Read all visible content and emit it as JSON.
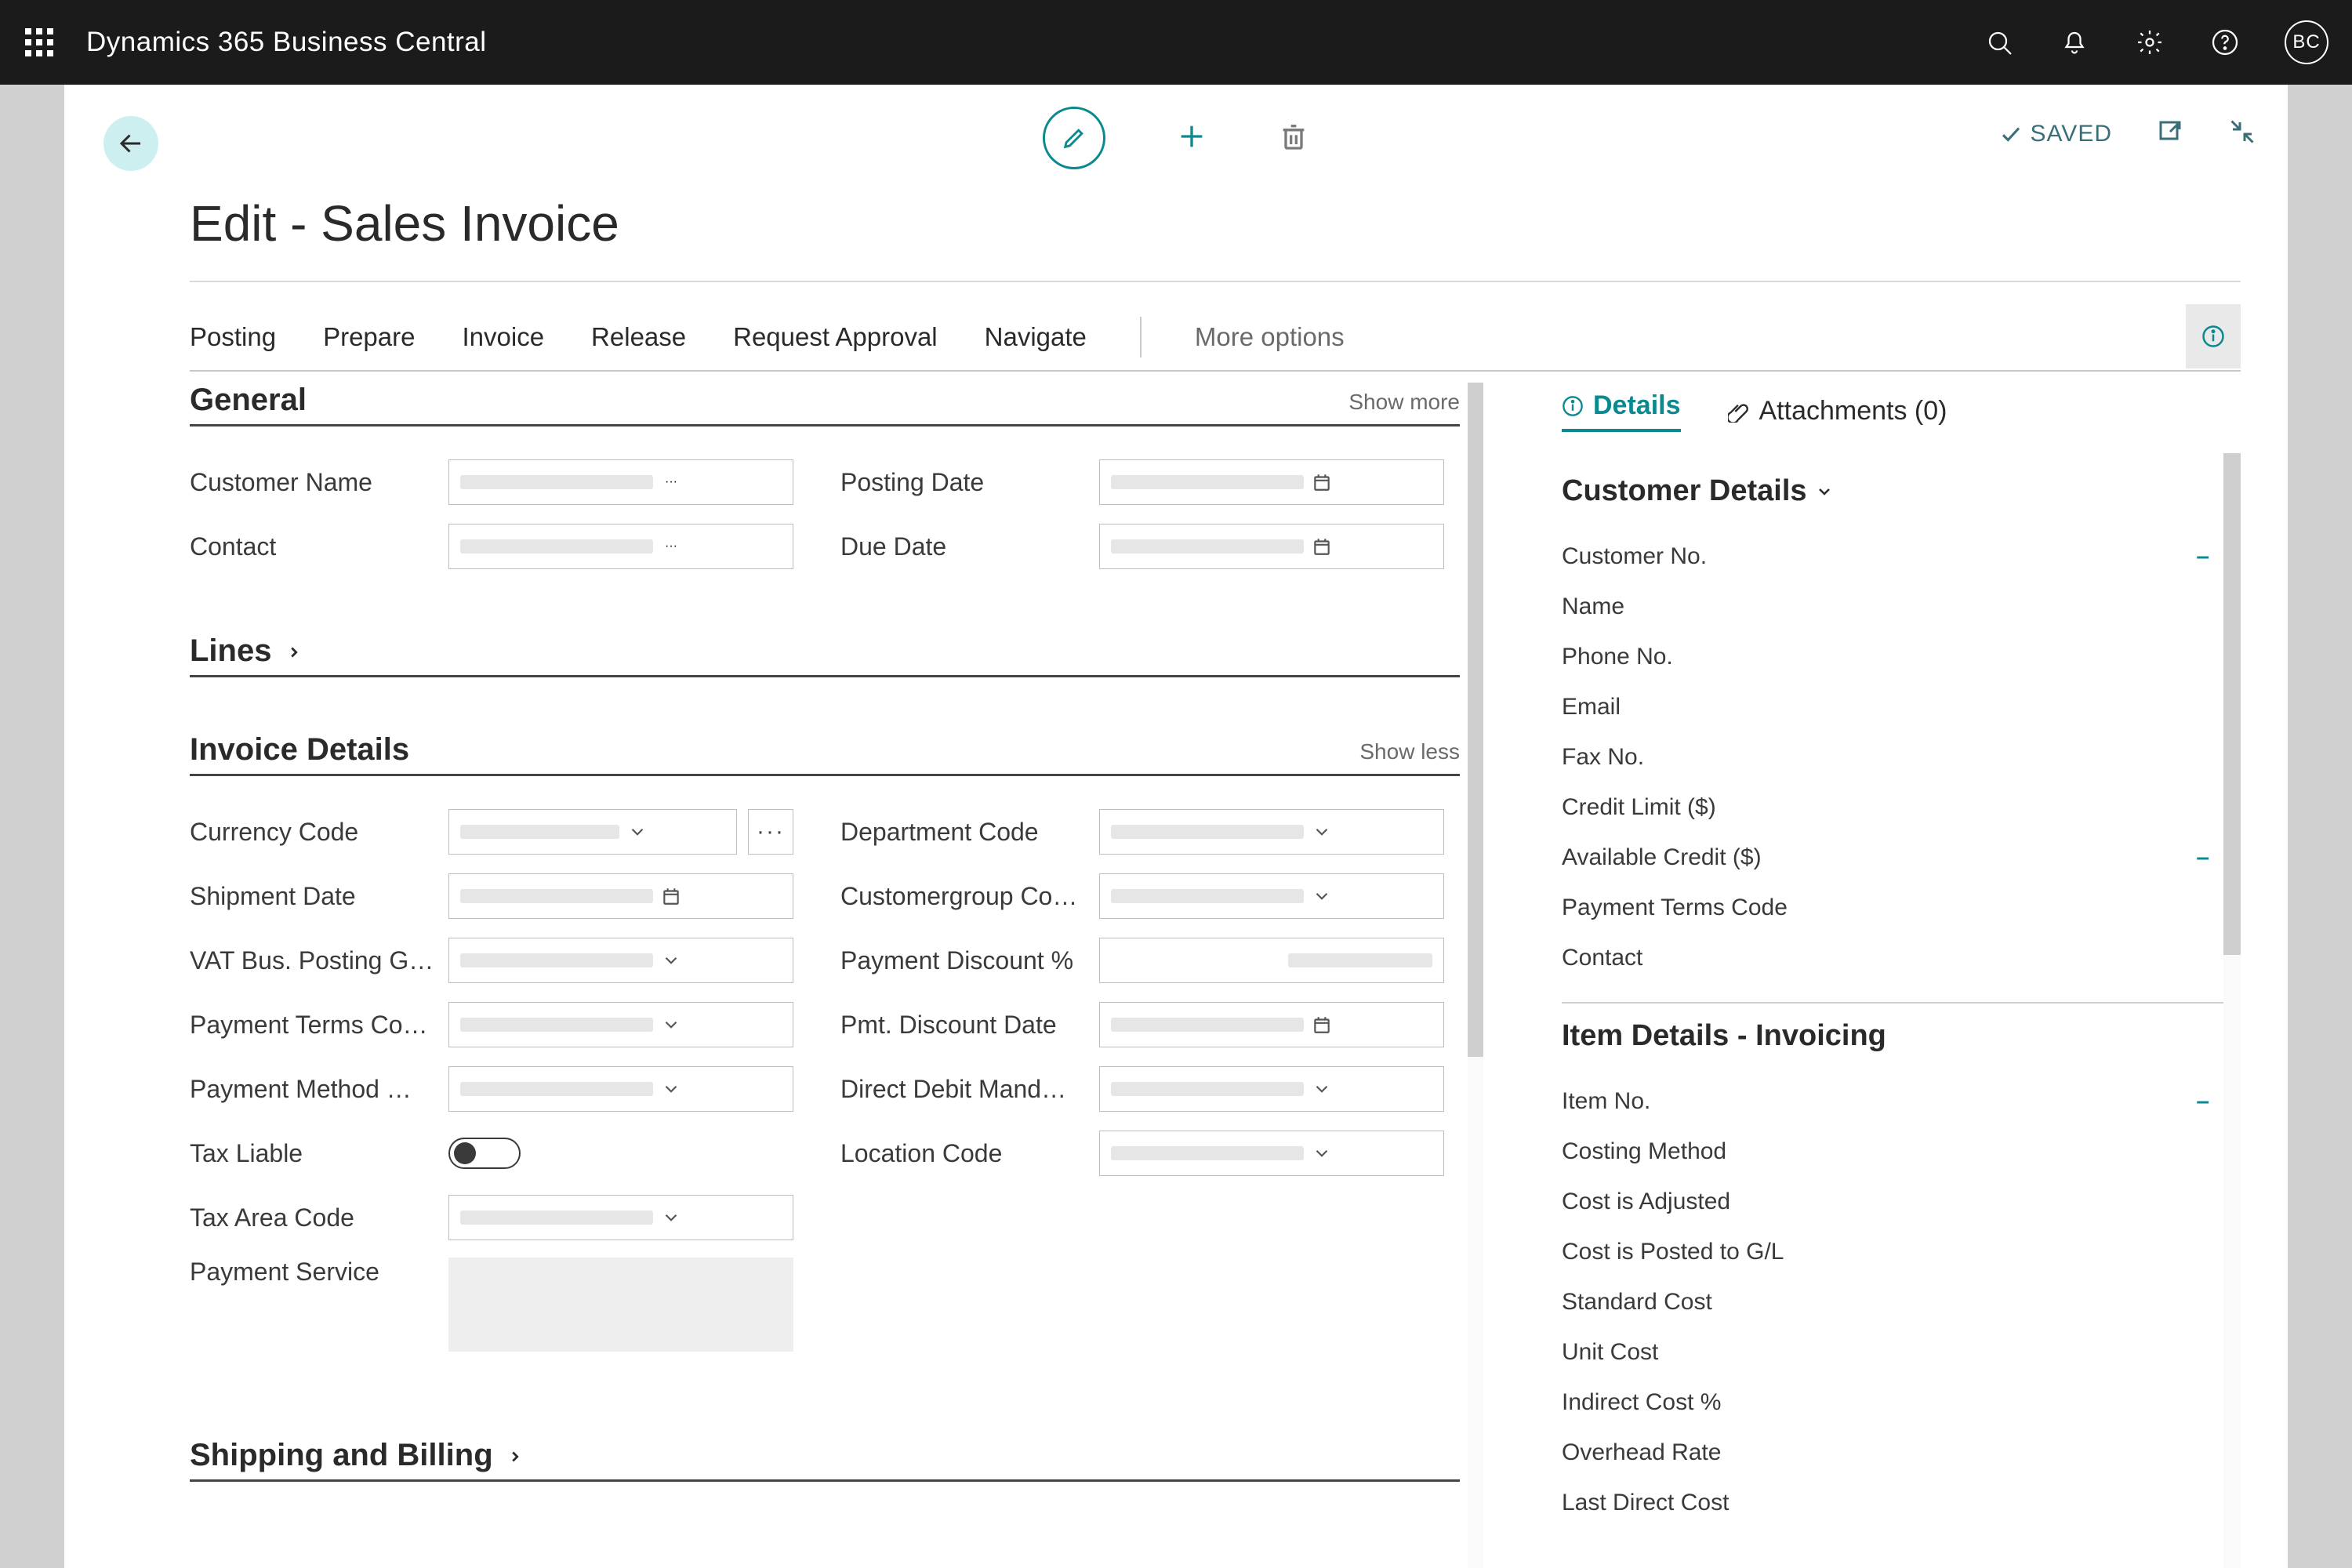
{
  "topbar": {
    "brand": "Dynamics 365 Business Central",
    "avatar": "BC"
  },
  "page": {
    "title": "Edit - Sales Invoice",
    "saved": "SAVED"
  },
  "actions": {
    "posting": "Posting",
    "prepare": "Prepare",
    "invoice": "Invoice",
    "release": "Release",
    "request_approval": "Request Approval",
    "navigate": "Navigate",
    "more_options": "More options"
  },
  "sections": {
    "general": {
      "title": "General",
      "show_more": "Show more"
    },
    "lines": {
      "title": "Lines"
    },
    "invoice_details": {
      "title": "Invoice Details",
      "show_less": "Show less"
    },
    "shipping": {
      "title": "Shipping and Billing"
    }
  },
  "general_fields": {
    "customer_name": "Customer Name",
    "contact": "Contact",
    "posting_date": "Posting Date",
    "due_date": "Due Date"
  },
  "invoice_fields": {
    "currency_code": "Currency Code",
    "shipment_date": "Shipment Date",
    "vat_bus": "VAT Bus. Posting G…",
    "payment_terms": "Payment Terms Co…",
    "payment_method": "Payment Method …",
    "tax_liable": "Tax Liable",
    "tax_area": "Tax Area Code",
    "payment_service": "Payment Service",
    "department_code": "Department Code",
    "customergroup": "Customergroup Co…",
    "pay_disc_pct": "Payment Discount %",
    "pmt_disc_date": "Pmt. Discount Date",
    "direct_debit": "Direct Debit Mand…",
    "location_code": "Location Code"
  },
  "factbox": {
    "details_tab": "Details",
    "attachments_tab": "Attachments (0)",
    "customer_details": "Customer Details",
    "item_details": "Item Details - Invoicing",
    "cust_rows": {
      "no": "Customer No.",
      "name": "Name",
      "phone": "Phone No.",
      "email": "Email",
      "fax": "Fax No.",
      "credit_limit": "Credit Limit ($)",
      "available_credit": "Available Credit ($)",
      "payment_terms": "Payment Terms Code",
      "contact": "Contact"
    },
    "item_rows": {
      "item_no": "Item No.",
      "costing_method": "Costing Method",
      "cost_adjusted": "Cost is Adjusted",
      "cost_posted": "Cost is Posted to G/L",
      "standard_cost": "Standard Cost",
      "unit_cost": "Unit Cost",
      "indirect_cost": "Indirect Cost %",
      "overhead_rate": "Overhead Rate",
      "last_direct_cost": "Last Direct Cost"
    },
    "dash": "–"
  }
}
